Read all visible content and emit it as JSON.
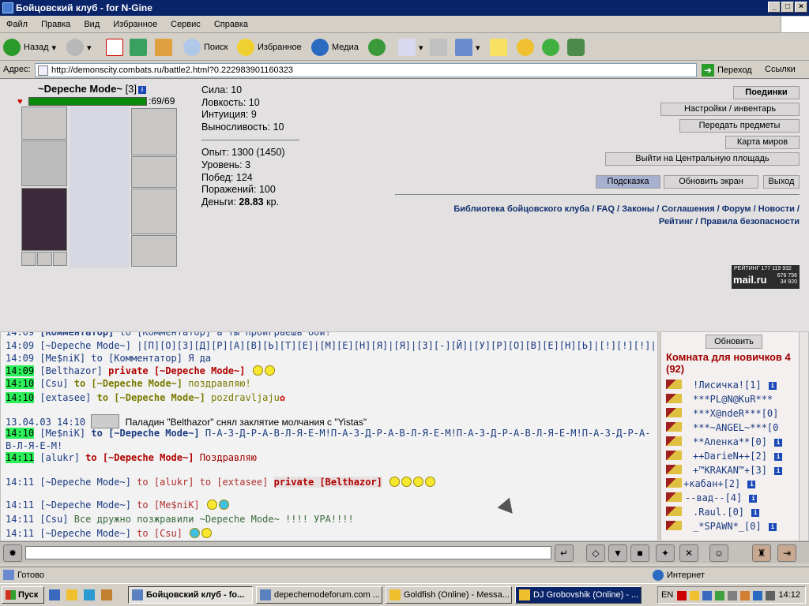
{
  "window": {
    "title": "Бойцовский клуб - for N-Gine"
  },
  "menu": [
    "Файл",
    "Правка",
    "Вид",
    "Избранное",
    "Сервис",
    "Справка"
  ],
  "toolbar": {
    "back": "Назад",
    "search": "Поиск",
    "favorites": "Избранное",
    "media": "Медиа"
  },
  "address": {
    "label": "Адрес:",
    "url": "http://demonscity.combats.ru/battle2.html?0.222983901160323",
    "go": "Переход",
    "links": "Ссылки"
  },
  "character": {
    "name": "~Depeche Mode~",
    "level": "[3]",
    "hp": ":69/69",
    "hp_fraction": 1.0
  },
  "stats": {
    "strength": "Сила: 10",
    "agility": "Ловкость: 10",
    "intuition": "Интуиция: 9",
    "endurance": "Выносливость: 10",
    "experience": "Опыт: 1300 (1450)",
    "level": "Уровень: 3",
    "wins": "Побед: 124",
    "losses": "Поражений: 100",
    "money_label": "Деньги:",
    "money_value": "28.83",
    "money_unit": "кр."
  },
  "buttons": {
    "duels": "Поединки",
    "settings": "Настройки / инвентарь",
    "transfer": "Передать предметы",
    "map": "Карта миров",
    "central": "Выйти на Центральную площадь",
    "hint": "Подсказка",
    "refresh_screen": "Обновить экран",
    "exit": "Выход"
  },
  "links": {
    "row1": [
      "Библиотека бойцовского клуба",
      "FAQ",
      "Законы",
      "Соглашения",
      "Форум",
      "Новости"
    ],
    "row2": [
      "Рейтинг",
      "Правила безопасности"
    ]
  },
  "rating_badge": {
    "label": "РЕЙТИНГ",
    "v1": "177 119 932",
    "v2": "676 756",
    "v3": "34 920",
    "brand": "mail.ru"
  },
  "chat": [
    {
      "time": "14:09",
      "from": "[Комментатор]",
      "to": "to [Комментатор]",
      "text": "а ты проиграешь бой!"
    },
    {
      "time": "14:09",
      "from": "[~Depeche Mode~]",
      "text": "|[П][О][З][Д][Р][А][В][Ь][Т][Е]|[М][Е][Н][Я]|[Я]|[З][-][Й]|[У][Р][О][В][Е][Н][Ь]|[!][!][!]|"
    },
    {
      "time": "14:09",
      "from": "[Me$niK]",
      "to": "to [Комментатор]",
      "text": "Я да"
    },
    {
      "time": "14:09",
      "from": "[Belthazor]",
      "private": "private [~Depeche Mode~]"
    },
    {
      "time": "14:10",
      "from": "[Csu]",
      "to": "to [~Depeche Mode~]",
      "text": "поздравляю!"
    },
    {
      "time": "14:10",
      "from": "[extasee]",
      "to": "to [~Depeche Mode~]",
      "text": "pozdravljaju"
    },
    {
      "date": "13.04.03 14:10",
      "text": "Паладин \"Belthazor\" снял заклятие молчания с \"Yistas\""
    },
    {
      "time": "14:10",
      "from": "[Me$niK]",
      "to": "to [~Depeche Mode~]",
      "text": "П-А-З-Д-Р-А-В-Л-Я-Е-М!П-А-З-Д-Р-А-В-Л-Я-Е-М!П-А-З-Д-Р-А-В-Л-Я-Е-М!П-А-З-Д-Р-А-В-Л-Я-Е-М!"
    },
    {
      "time": "14:11",
      "from": "[alukr]",
      "to": "to [~Depeche Mode~]",
      "text": "Поздравляю"
    },
    {
      "time": "14:11",
      "from": "[~Depeche Mode~]",
      "to": "to [alukr] to [extasee]",
      "private": "private [Belthazor]"
    },
    {
      "time": "14:11",
      "from": "[~Depeche Mode~]",
      "to": "to [Me$niK]"
    },
    {
      "time": "14:11",
      "from": "[Csu]",
      "text": "Все дружно позжравили ~Depeche Mode~ !!!! УРА!!!!"
    },
    {
      "time": "14:11",
      "from": "[~Depeche Mode~]",
      "to": "to [Csu]"
    }
  ],
  "room": {
    "refresh": "Обновить",
    "title": "Комната для новичков 4 (92)",
    "users": [
      "!Лисичка![1]",
      "***PL@N@KuR***",
      "***X@ndeR***[0]",
      "***~ANGEL~***[0",
      "**Аленка**[0]",
      "++DarieN++[2]",
      "+™KRAKAN™+[3]",
      "+кабан+[2]",
      "--вад--[4]",
      ".Raul.[0]",
      "_*SPAWN*_[0]"
    ]
  },
  "status": {
    "ready": "Готово",
    "zone": "Интернет"
  },
  "taskbar": {
    "start": "Пуск",
    "tasks": [
      "Бойцовский клуб - fo...",
      "depechemodeforum.com ...",
      "Goldfish (Online) - Messa...",
      "DJ Grobovshik (Online) - ..."
    ],
    "lang": "EN",
    "clock": "14:12"
  }
}
